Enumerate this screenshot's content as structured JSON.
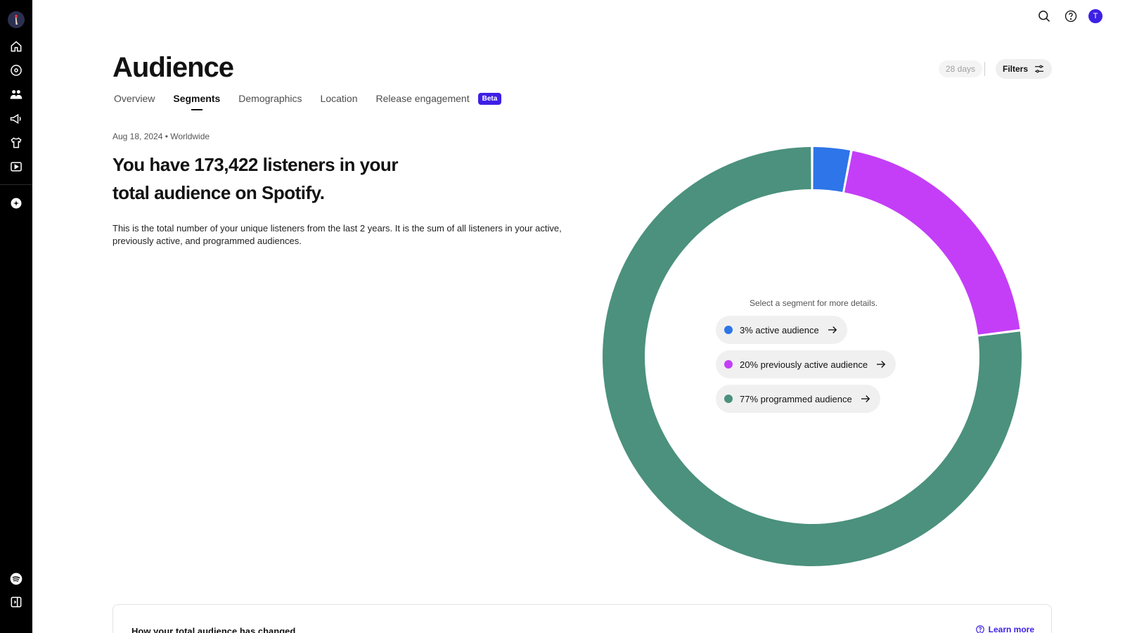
{
  "sidebar": {
    "items": [
      {
        "icon": "home-icon"
      },
      {
        "icon": "music-disc-icon"
      },
      {
        "icon": "audience-icon",
        "active": true
      },
      {
        "icon": "campaigns-icon"
      },
      {
        "icon": "merch-icon"
      },
      {
        "icon": "video-icon"
      },
      {
        "icon": "marketplace-icon"
      }
    ],
    "bottom": [
      {
        "icon": "spotify-logo-icon"
      },
      {
        "icon": "collapse-sidebar-icon"
      }
    ]
  },
  "topbar": {
    "user_initial": "T"
  },
  "header": {
    "title": "Audience",
    "tabs": [
      {
        "label": "Overview"
      },
      {
        "label": "Segments",
        "active": true
      },
      {
        "label": "Demographics"
      },
      {
        "label": "Location"
      },
      {
        "label": "Release engagement"
      }
    ],
    "beta_label": "Beta",
    "period": "28 days",
    "filters_label": "Filters"
  },
  "summary": {
    "date_line": "Aug 18, 2024 • Worldwide",
    "headline": "You have 173,422 listeners in your total audience on Spotify.",
    "description": "This is the total number of your unique listeners from the last 2 years. It is the sum of all listeners in your active, previously active, and programmed audiences."
  },
  "chart_data": {
    "type": "pie",
    "donut": true,
    "series": [
      {
        "name": "active audience",
        "value": 3,
        "color": "#2d75e8"
      },
      {
        "name": "previously active audience",
        "value": 20,
        "color": "#c43ef7"
      },
      {
        "name": "programmed audience",
        "value": 77,
        "color": "#4b917d"
      }
    ]
  },
  "segments": {
    "hint": "Select a segment for more details.",
    "items": [
      {
        "label": "3% active audience",
        "color": "#2d75e8"
      },
      {
        "label": "20% previously active audience",
        "color": "#c43ef7"
      },
      {
        "label": "77% programmed audience",
        "color": "#4b917d"
      }
    ]
  },
  "card": {
    "title": "How your total audience has changed",
    "learn_more": "Learn more"
  }
}
